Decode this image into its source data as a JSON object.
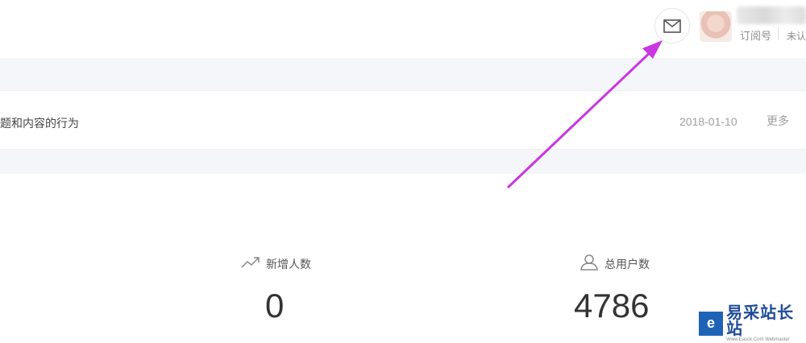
{
  "header": {
    "account_type": "订阅号",
    "account_status": "未认",
    "icons": {
      "mail": "mail-icon",
      "avatar": "avatar"
    }
  },
  "notice": {
    "text": "题和内容的行为",
    "date": "2018-01-10",
    "more_label": "更多"
  },
  "stats": {
    "new_users": {
      "label": "新增人数",
      "value": "0",
      "icon": "trend-up-icon"
    },
    "total_users": {
      "label": "总用户数",
      "value": "4786",
      "icon": "user-icon"
    }
  },
  "watermark": {
    "logo_letter": "e",
    "main": "易采站长站",
    "sub": "Www.Easck.Com Webmaster"
  },
  "colors": {
    "annotation_arrow": "#c837e0",
    "band": "#f5f6f9",
    "watermark_blue": "#1e63b6"
  }
}
